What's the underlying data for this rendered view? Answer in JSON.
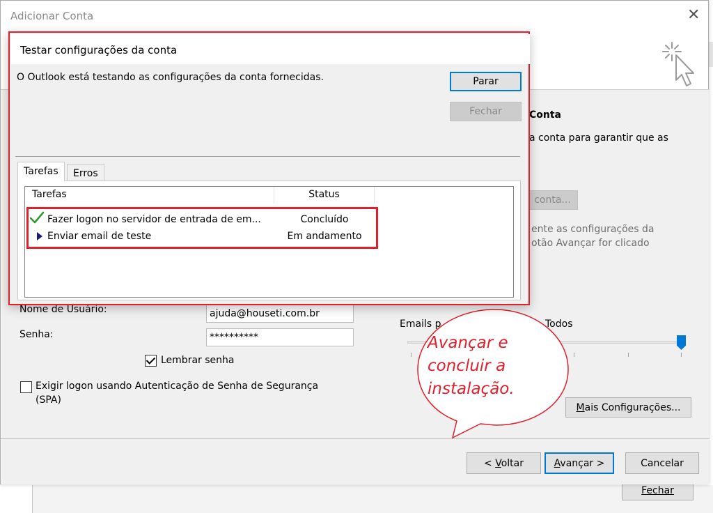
{
  "main_dialog": {
    "title": "Adicionar Conta",
    "close_glyph": "✕"
  },
  "partial_right": {
    "heading": "Conta",
    "text1": "a conta para garantir que as",
    "button": "conta...",
    "text2": "ente as configurações da",
    "text3": "otão Avançar for clicado"
  },
  "account": {
    "username_label": "Nome de Usuário:",
    "username_value": "ajuda@houseti.com.br",
    "password_label": "Senha:",
    "password_value": "**********",
    "remember_label": "Lembrar senha",
    "spa_line1": "Exigir logon usando Autenticação de Senha de Segurança",
    "spa_line2": "(SPA)"
  },
  "offline": {
    "label_start": "Emails p",
    "label_end": "Todos"
  },
  "more_settings": "Mais Configurações...",
  "footer": {
    "back": "< Voltar",
    "next": "Avançar >",
    "cancel": "Cancelar"
  },
  "background_window": {
    "close": "Fechar"
  },
  "test_dialog": {
    "title": "Testar configurações da conta",
    "message": "O Outlook está testando as configurações da conta fornecidas.",
    "stop_button": "Parar",
    "close_button": "Fechar",
    "tabs": [
      "Tarefas",
      "Erros"
    ],
    "columns": [
      "Tarefas",
      "Status"
    ],
    "rows": [
      {
        "icon": "checkmark-icon",
        "task": "Fazer logon no servidor de entrada de em...",
        "status": "Concluído"
      },
      {
        "icon": "play-arrow-icon",
        "task": "Enviar email de teste",
        "status": "Em andamento"
      }
    ]
  },
  "annotation": {
    "text": "Avançar e concluir a instalação.",
    "color": "#e0202c"
  },
  "colors": {
    "accent": "#0078d7",
    "highlight_red": "#e0202c",
    "check_green": "#2a9a2a",
    "arrow_navy": "#1a1a80"
  }
}
